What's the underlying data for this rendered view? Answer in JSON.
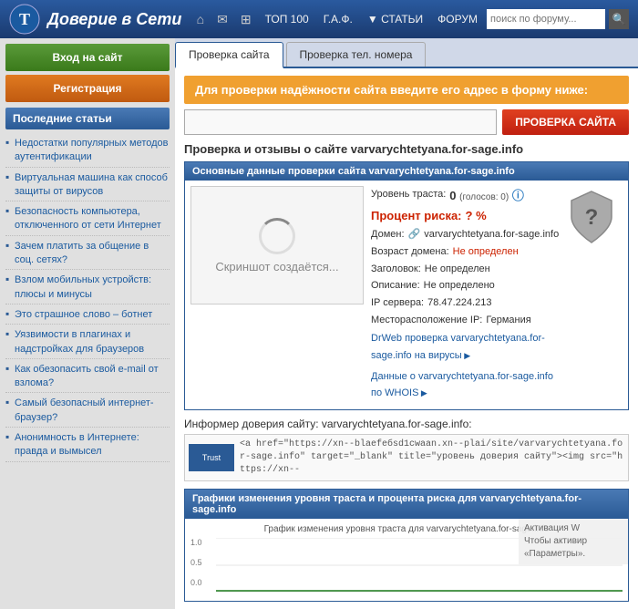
{
  "header": {
    "title": "Доверие в Сети",
    "search_placeholder": "поиск по форуму...",
    "nav_items": [
      "ТОП 100",
      "Г.А.Ф.",
      "▼ СТАТЬИ",
      "ФОРУМ"
    ]
  },
  "sidebar": {
    "login_btn": "Вход на сайт",
    "register_btn": "Регистрация",
    "section_title": "Последние статьи",
    "articles": [
      "Недостатки популярных методов аутентификации",
      "Виртуальная машина как способ защиты от вирусов",
      "Безопасность компьютера, отключенного от сети Интернет",
      "Зачем платить за общение в соц. сетях?",
      "Взлом мобильных устройств: плюсы и минусы",
      "Это страшное слово – ботнет",
      "Уязвимости в плагинах и надстройках для браузеров",
      "Как обезопасить свой e-mail от взлома?",
      "Самый безопасный интернет-браузер?",
      "Анонимность в Интернете: правда и вымысел"
    ]
  },
  "tabs": {
    "tab1": "Проверка сайта",
    "tab2": "Проверка тел. номера"
  },
  "check": {
    "prompt": "Для проверки надёжности сайта введите его адрес в форму ниже:",
    "input_placeholder": "",
    "check_btn": "ПРОВЕРКА САЙТА"
  },
  "result": {
    "title": "Проверка и отзывы о сайте varvarychtetyana.for-sage.info",
    "data_section_title": "Основные данные проверки сайта varvarychtetyana.for-sage.info",
    "screenshot_text": "Скриншот создаётся...",
    "trust_label": "Уровень траста:",
    "trust_value": "0",
    "trust_suffix": "(голосов: 0)",
    "percent_label": "Процент риска:",
    "percent_value": "? %",
    "domain_label": "Домен:",
    "domain_value": "varvarychtetyana.for-sage.info",
    "age_label": "Возраст домена:",
    "age_value": "Не определен",
    "header_label": "Заголовок:",
    "header_value": "Не определен",
    "description_label": "Описание:",
    "description_value": "Не определено",
    "ip_label": "IP сервера:",
    "ip_value": "78.47.224.213",
    "location_label": "Месторасположение IP:",
    "location_value": "Германия",
    "link1": "DrWeb проверка varvarychtetyana.for-sage.info на вирусы",
    "link2": "Данные о varvarychtetyana.for-sage.info по WHOIS"
  },
  "informer": {
    "title": "Информер доверия сайту: varvarychtetyana.for-sage.info:",
    "logo_text": "Trust",
    "code": "<a href=\"https://xn--blaefeбsd1cwaan.xn--plai/site/varvarychtetyana.for-sage.info\" target=\"_blank\" title=\"уровень доверия сайту\"><img src=\"https://xn--"
  },
  "graph": {
    "section_title": "Графики изменения уровня траста и процента риска для varvarychtetyana.for-sage.info",
    "subtitle": "График изменения уровня траста для varvarychtetyana.for-sage.info",
    "y_labels": [
      "1.0",
      "0.5",
      "0.0"
    ]
  },
  "watermark": {
    "line1": "Активация W",
    "line2": "Чтобы активир",
    "line3": "«Параметры»."
  }
}
